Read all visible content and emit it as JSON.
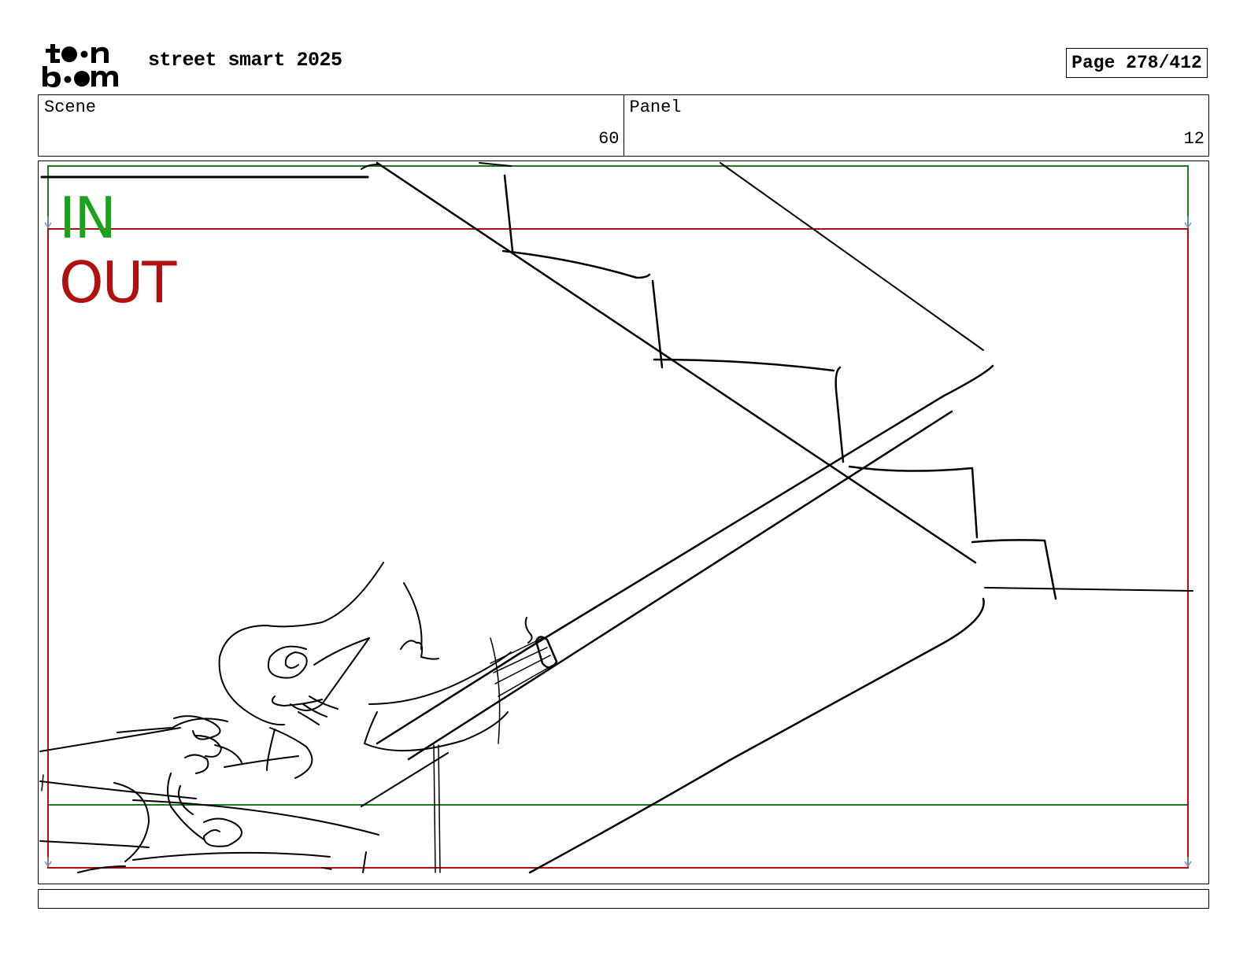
{
  "header": {
    "logo_text": "toon boom",
    "project_title": "street smart 2025",
    "page_label": "Page 278/412"
  },
  "info": {
    "scene_label": "Scene",
    "scene_value": "60",
    "panel_label": "Panel",
    "panel_value": "12"
  },
  "panel": {
    "camera_in_label": "IN",
    "camera_out_label": "OUT",
    "colors": {
      "in_frame": "#1f7a1f",
      "out_frame": "#b01010",
      "in_text": "#1aa31a",
      "out_text": "#b01010",
      "sketch": "#000000"
    }
  },
  "caption": {
    "text": ""
  }
}
